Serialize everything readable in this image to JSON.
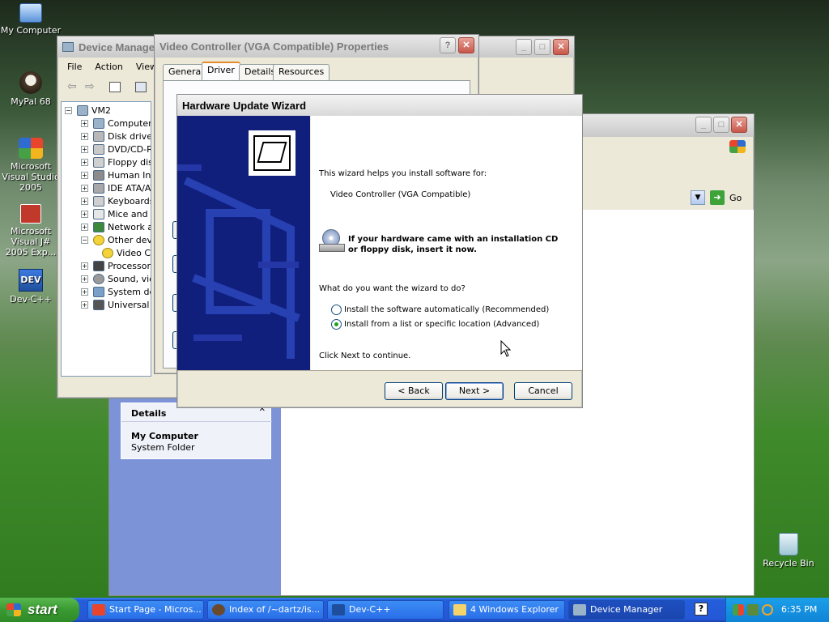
{
  "desktop": {
    "icons": [
      {
        "label": "My Computer"
      },
      {
        "label": "MyPal 68"
      },
      {
        "label": "Microsoft Visual Studio 2005"
      },
      {
        "label": "Microsoft Visual J# 2005 Exp..."
      },
      {
        "label": "Dev-C++"
      },
      {
        "label": "Recycle Bin"
      }
    ]
  },
  "device_manager": {
    "title": "Device Manager",
    "menu": [
      "File",
      "Action",
      "View"
    ],
    "tree": {
      "root": "VM2",
      "items": [
        "Computer",
        "Disk drives",
        "DVD/CD-RC",
        "Floppy disk",
        "Human Inte",
        "IDE ATA/AT",
        "Keyboards",
        "Mice and ot",
        "Network ac",
        "Other devic",
        "Video C",
        "Processors",
        "Sound, vide",
        "System dev",
        "Universal S"
      ]
    }
  },
  "properties": {
    "title": "Video Controller (VGA Compatible) Properties",
    "tabs": [
      "General",
      "Driver",
      "Details",
      "Resources"
    ],
    "active_tab": "Driver"
  },
  "explorer": {
    "go_label": "Go",
    "details_title": "Details",
    "details_name": "My Computer",
    "details_type": "System Folder"
  },
  "wizard": {
    "title": "Hardware Update Wizard",
    "intro": "This wizard helps you install software for:",
    "device": "Video Controller (VGA Compatible)",
    "cd_notice": "If your hardware came with an installation CD or floppy disk, insert it now.",
    "question": "What do you want the wizard to do?",
    "options": [
      {
        "label": "Install the software automatically (Recommended)",
        "selected": false
      },
      {
        "label": "Install from a list or specific location (Advanced)",
        "selected": true
      }
    ],
    "continue_text": "Click Next to continue.",
    "buttons": {
      "back": "< Back",
      "next": "Next >",
      "cancel": "Cancel"
    },
    "banner_color": "#101e7c"
  },
  "taskbar": {
    "start_label": "start",
    "items": [
      {
        "label": "Start Page - Micros..."
      },
      {
        "label": "Index of /~dartz/is..."
      },
      {
        "label": "Dev-C++"
      },
      {
        "label": "4 Windows Explorer"
      },
      {
        "label": "Device Manager"
      }
    ],
    "clock": "6:35 PM"
  }
}
